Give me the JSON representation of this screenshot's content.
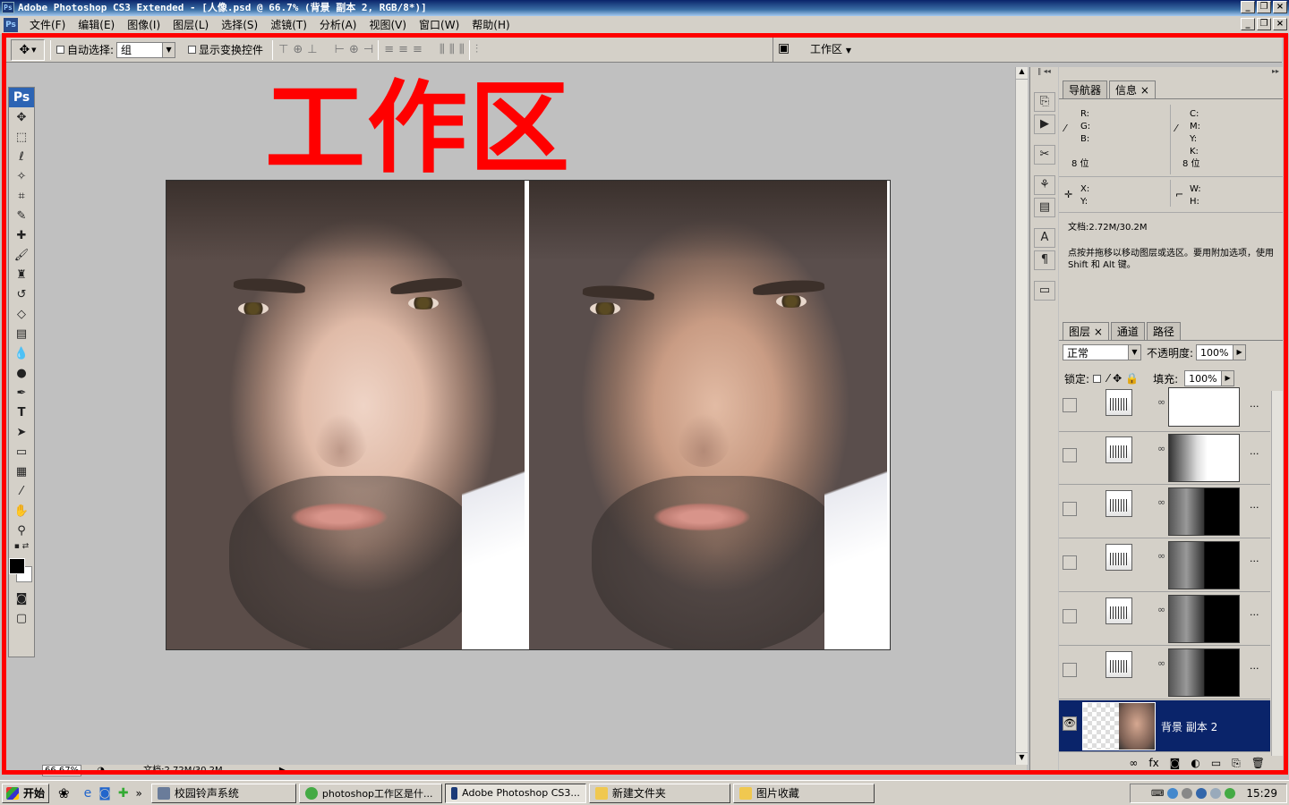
{
  "window": {
    "title": "Adobe Photoshop CS3 Extended - [人像.psd @ 66.7% (背景 副本 2, RGB/8*)]"
  },
  "menubar": {
    "items": [
      "文件(F)",
      "编辑(E)",
      "图像(I)",
      "图层(L)",
      "选择(S)",
      "滤镜(T)",
      "分析(A)",
      "视图(V)",
      "窗口(W)",
      "帮助(H)"
    ]
  },
  "options": {
    "auto_select_label": "自动选择:",
    "auto_select_value": "组",
    "show_transform_label": "显示变换控件",
    "workspace_label": "工作区"
  },
  "annotation": {
    "text": "工作区",
    "color": "#ff0000"
  },
  "statusbar": {
    "zoom": "66.67%",
    "doc": "文档:2.72M/30.2M"
  },
  "info_panel": {
    "tabs": [
      "导航器",
      "信息"
    ],
    "rgb": [
      "R:",
      "G:",
      "B:"
    ],
    "cmyk": [
      "C:",
      "M:",
      "Y:",
      "K:"
    ],
    "bitdepth_left": "8 位",
    "bitdepth_right": "8 位",
    "xy": [
      "X:",
      "Y:"
    ],
    "wh": [
      "W:",
      "H:"
    ],
    "doc": "文档:2.72M/30.2M",
    "hint": "点按并拖移以移动图层或选区。要用附加选项，使用 Shift 和 Alt 键。"
  },
  "layers_panel": {
    "tabs": [
      "图层",
      "通道",
      "路径"
    ],
    "blend_mode": "正常",
    "opacity_label": "不透明度:",
    "opacity": "100%",
    "lock_label": "锁定:",
    "fill_label": "填充:",
    "fill": "100%",
    "active_layer": "背景 副本 2",
    "dots": "..."
  },
  "taskbar": {
    "start": "开始",
    "tasks": [
      "校园铃声系统",
      "photoshop工作区是什...",
      "Adobe Photoshop CS3...",
      "新建文件夹",
      "图片收藏"
    ],
    "clock": "15:29"
  },
  "colors": {
    "accent": "#0a246a",
    "annotation": "#ff0000",
    "chrome": "#d4d0c8"
  }
}
